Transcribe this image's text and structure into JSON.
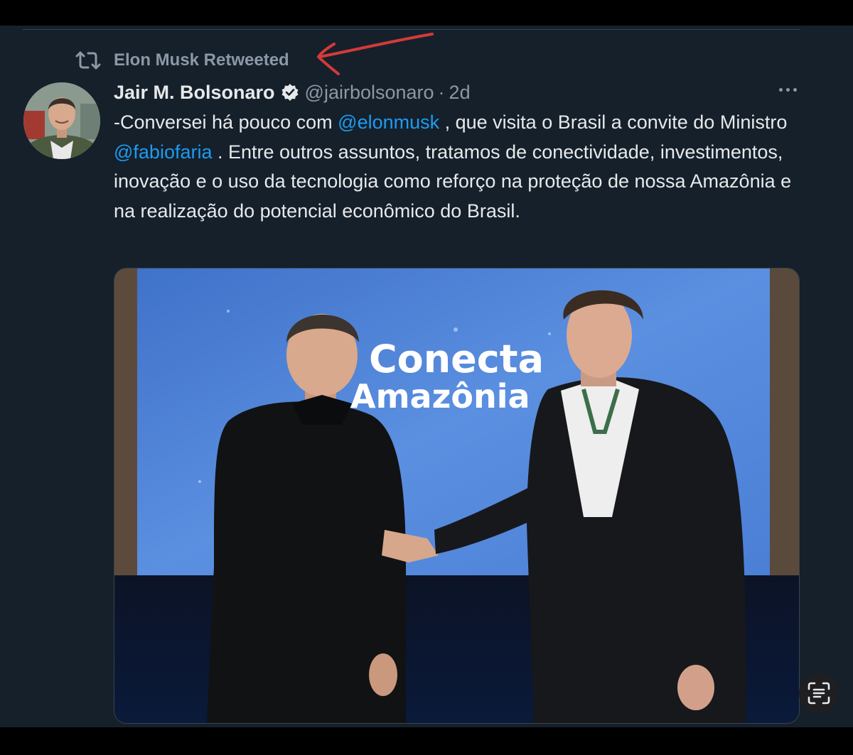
{
  "retweet": {
    "label": "Elon Musk Retweeted",
    "icon": "retweet-icon"
  },
  "annotation": {
    "arrow_color": "#d43a3a"
  },
  "tweet": {
    "author_name": "Jair M. Bolsonaro",
    "verified": true,
    "handle": "@jairbolsonaro",
    "separator": "·",
    "time": "2d",
    "text_parts": [
      "-Conversei há pouco com ",
      "@elonmusk",
      " , que visita o Brasil a convite do Ministro ",
      "@fabiofaria",
      " . Entre outros assuntos, tratamos de conectividade, investimentos, inovação e o uso da tecnologia como reforço na proteção de nossa Amazônia e na realização do potencial econômico do Brasil."
    ],
    "media": {
      "banner_line1": "Conecta",
      "banner_line2": "Amazônia"
    }
  },
  "colors": {
    "background": "#15202b",
    "text": "#e7e9ea",
    "secondary": "#8b98a5",
    "link": "#1d9bf0"
  }
}
